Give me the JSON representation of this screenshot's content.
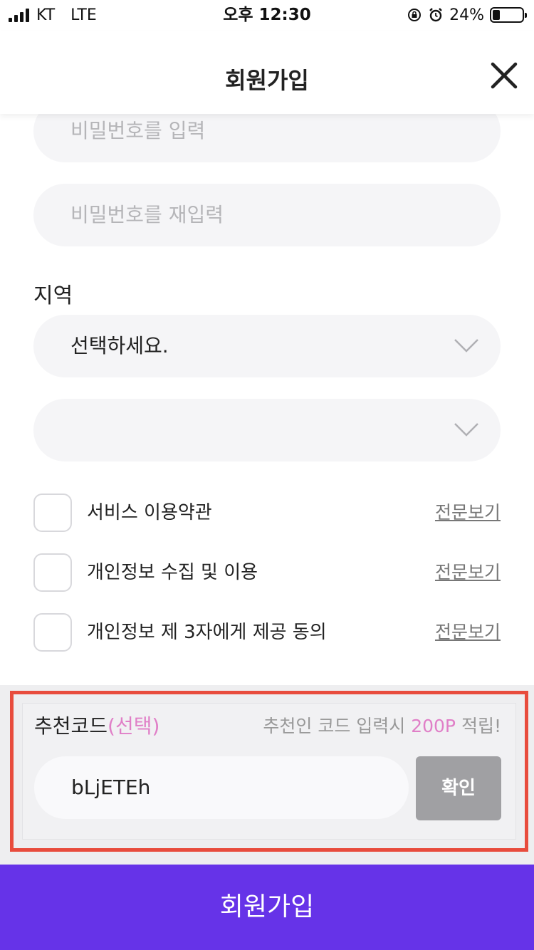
{
  "status_bar": {
    "carrier": "KT",
    "network": "LTE",
    "time": "오후 12:30",
    "battery": "24%",
    "battery_level": 0.24
  },
  "header": {
    "title": "회원가입",
    "close_icon": "close-icon"
  },
  "form": {
    "password_placeholder": "비밀번호를 입력",
    "password_confirm_placeholder": "비밀번호를 재입력",
    "region_label": "지역",
    "region_select_value": "선택하세요.",
    "region_sub_select_value": ""
  },
  "agreements": [
    {
      "label": "서비스 이용약관",
      "link": "전문보기",
      "checked": false
    },
    {
      "label": "개인정보 수집 및 이용",
      "link": "전문보기",
      "checked": false
    },
    {
      "label": "개인정보 제 3자에게 제공 동의",
      "link": "전문보기",
      "checked": false
    }
  ],
  "referral": {
    "label": "추천코드",
    "optional": "(선택)",
    "note_prefix": "추천인 코드 입력시 ",
    "note_points": "200P",
    "note_suffix": " 적립!",
    "code_value": "bLjETEh",
    "confirm_label": "확인"
  },
  "submit_label": "회원가입",
  "colors": {
    "accent": "#6633e8",
    "highlight_border": "#e84c3d",
    "pink": "#e07fc7",
    "field_bg": "#f5f5f7"
  }
}
